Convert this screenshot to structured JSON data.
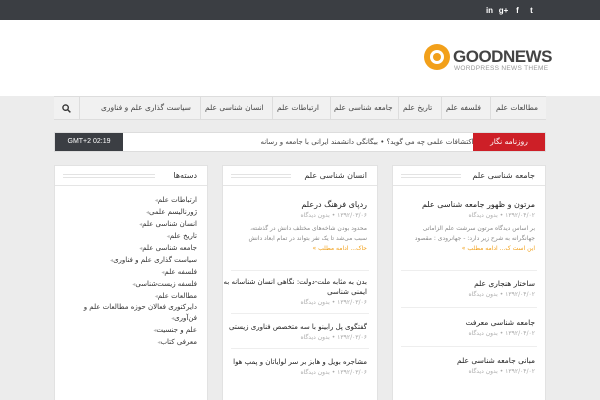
{
  "social": [
    "in",
    "g+",
    "f",
    "t"
  ],
  "social_icons": [
    "linkedin-icon",
    "google-plus-icon",
    "facebook-icon",
    "twitter-icon"
  ],
  "logo": {
    "title": "GOODNEWS",
    "subtitle": "WORDPRESS NEWS THEME"
  },
  "nav": {
    "items": [
      "مطالعات علم",
      "فلسفه علم",
      "تاریخ علم",
      "جامعه شناسی علم",
      "ارتباطات علم",
      "انسان شناسی علم",
      "سیاست گذاری علم و فناوری"
    ]
  },
  "ticker": {
    "label": "روزنامه نگار",
    "time": "GMT+2 02:19",
    "text": "تاریخ علم درباره اکتشافات علمی چه می گوید؟ • بیگانگی دانشمند ایرانی با جامعه و رسانه"
  },
  "categories": {
    "title": "دسته‌ها",
    "items": [
      "ارتباطات علم",
      "ژورنالیسم علمی",
      "انسان شناسی علم",
      "تاریخ علم",
      "جامعه شناسی علم",
      "سیاست گذاری علم و فناوری",
      "فلسفه علم",
      "فلسفه زیست‌شناسی",
      "مطالعات علم",
      "دایرکتوری فعالان حوزه مطالعات علم و فن‌آوری",
      "علم و جنسیت",
      "معرفی کتاب"
    ]
  },
  "anthropology": {
    "title": "انسان شناسی علم",
    "posts": [
      {
        "title": "ردپای فرهنگ درعلم",
        "meta": "۱۳۹۲/۰۳/۰۶ • بدون دیدگاه",
        "excerpt": [
          "محدود بودن شاخه‌های مختلف دانش در گذشته،",
          "سبب می‌شد تا یک نفر بتواند در تمام ابعاد دانش",
          "حاک... ادامه مطلب »"
        ]
      },
      {
        "title": "بدن به مثابه ملت-دولت: نگاهی انسان شناسانه به",
        "title2": "ایمنی شناسی",
        "meta": "۱۳۹۲/۰۳/۰۶ • بدون دیدگاه"
      },
      {
        "title": "گفتگوی پل رابینو با سه متخصص فناوری زیستی",
        "meta": "۱۳۹۲/۰۳/۰۶ • بدون دیدگاه"
      },
      {
        "title": "مشاجره بویل و هابز بر سر لوایاتان و پمپ هوا",
        "meta": "۱۳۹۲/۰۳/۰۶ • بدون دیدگاه"
      }
    ]
  },
  "sociology": {
    "title": "جامعه شناسی علم",
    "posts": [
      {
        "title": "مرتون و ظهور جامعه شناسی علم",
        "meta": "۱۳۹۲/۰۴/۰۲ • بدون دیدگاه",
        "excerpt": [
          "بر اساس دیدگاه مرتون سرشت علم الزاماتی",
          "جهانگرانه به شرح زیر دارد: - جهانرودی : مقصود",
          "این است ک... ادامه مطلب »"
        ]
      },
      {
        "title": "ساختار هنجاری علم",
        "meta": "۱۳۹۲/۰۴/۰۲ • بدون دیدگاه"
      },
      {
        "title": "جامعه شناسی معرفت",
        "meta": "۱۳۹۲/۰۴/۰۲ • بدون دیدگاه"
      },
      {
        "title": "مبانی جامعه شناسی علم",
        "meta": "۱۳۹۲/۰۴/۰۲ • بدون دیدگاه"
      }
    ]
  },
  "colors": {
    "topbar": "#3b3e43",
    "accent": "#f2a01a",
    "ticker_label": "#cd1f27"
  }
}
